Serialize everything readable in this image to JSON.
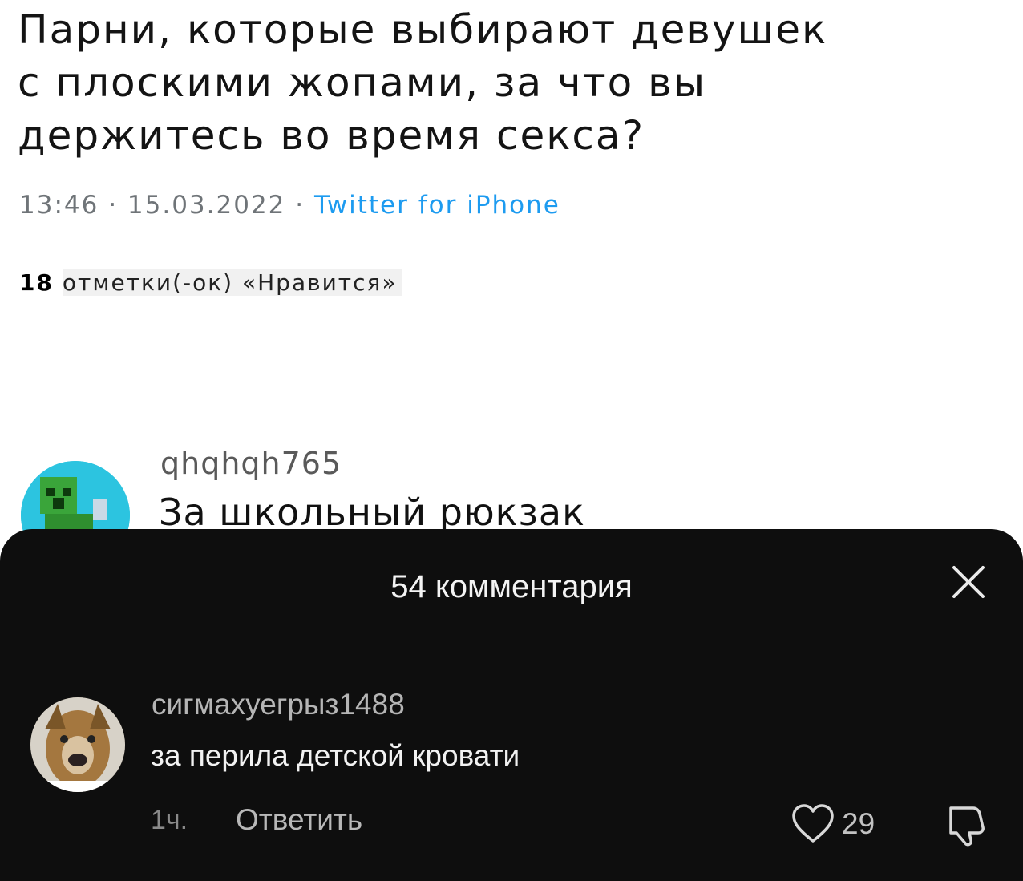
{
  "tweet": {
    "lines": [
      "Парни, которые выбирают девушек",
      "с плоскими жопами, за что вы",
      "держитесь во время секса?"
    ],
    "time": "13:46",
    "date": "15.03.2022",
    "separator": " · ",
    "source": "Twitter for iPhone",
    "likes_count": "18",
    "likes_label": "отметки(-ок) «Нравится»"
  },
  "top_comment": {
    "username": "qhqhqh765",
    "text": "За школьный рюкзак"
  },
  "sheet": {
    "title": "54 комментария",
    "close_icon": "close-icon",
    "comment": {
      "username": "сигмахуегрыз1488",
      "text": "за перила детской кровати",
      "time": "1ч.",
      "reply_label": "Ответить",
      "likes": "29",
      "like_icon": "heart-icon",
      "dislike_icon": "thumbs-down-icon"
    }
  },
  "colors": {
    "sheet_bg": "#0e0e0e",
    "twitter_source": "#1d9bf0",
    "avatar_bg": "#2cc4e0"
  }
}
